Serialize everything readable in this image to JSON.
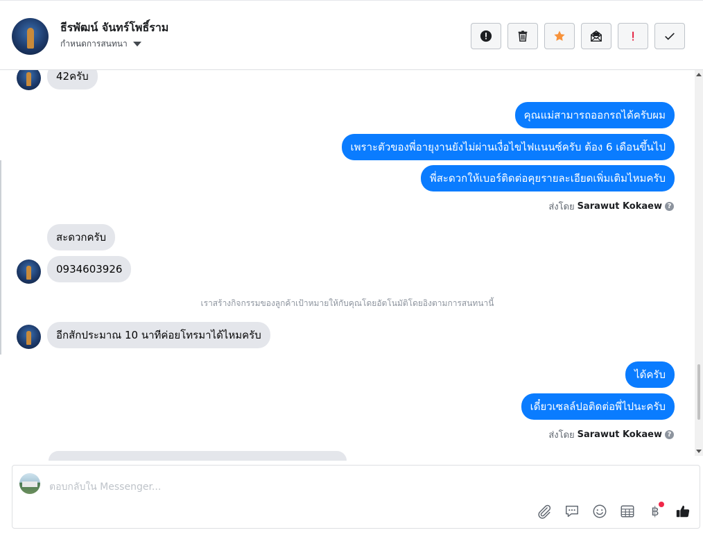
{
  "header": {
    "name": "ธีรพัฒน์ จันทร์โพธิ์ราม",
    "assign_label": "กำหนดการสนทนา",
    "toolbar": [
      {
        "id": "spam",
        "icon": "alert-circle-icon"
      },
      {
        "id": "delete",
        "icon": "trash-icon"
      },
      {
        "id": "star",
        "icon": "star-icon"
      },
      {
        "id": "unread",
        "icon": "envelope-open-icon"
      },
      {
        "id": "priority",
        "icon": "exclamation-icon"
      },
      {
        "id": "done",
        "icon": "check-icon"
      }
    ]
  },
  "messages": [
    {
      "dir": "in",
      "text": "42ครับ"
    },
    {
      "dir": "out",
      "text": "คุณแม่สามารถออกรถได้ครับผม"
    },
    {
      "dir": "out",
      "text": "เพราะตัวของพี่อายุงานยังไม่ผ่านเงื่อไขไฟแนนซ์ครับ ต้อง 6 เดือนขึ้นไป"
    },
    {
      "dir": "out",
      "text": "พี่สะดวกให้เบอร์ติดต่อคุยรายละเอียดเพิ่มเติมไหมครับ"
    },
    {
      "dir": "in",
      "text": "สะดวกครับ"
    },
    {
      "dir": "in",
      "text": "0934603926"
    },
    {
      "dir": "in",
      "text": "อีกสักประมาณ 10 นาทีค่อยโทรมาได้ไหมครับ"
    },
    {
      "dir": "out",
      "text": "ได้ครับ"
    },
    {
      "dir": "out",
      "text": "เดี๋ยวเซลล์ปอติดต่อพี่ไปนะครับ"
    }
  ],
  "sent_by": {
    "prefix": "ส่งโดย",
    "name": "Sarawut Kokaew"
  },
  "system_message": "เราสร้างกิจกรรมของลูกค้าเป้าหมายให้กับคุณโดยอัตโนมัติโดยอิงตามการสนทนานี้",
  "composer": {
    "placeholder": "ตอบกลับใน Messenger...",
    "tools": [
      {
        "id": "attach",
        "icon": "paperclip-icon"
      },
      {
        "id": "saved-replies",
        "icon": "speech-bubble-icon"
      },
      {
        "id": "emoji",
        "icon": "smiley-icon"
      },
      {
        "id": "appointment",
        "icon": "calendar-grid-icon"
      },
      {
        "id": "payment",
        "icon": "baht-icon",
        "glyph": "฿"
      },
      {
        "id": "like",
        "icon": "thumbs-up-icon"
      }
    ]
  },
  "colors": {
    "outgoing": "#0a7cff",
    "incoming": "#e4e6eb",
    "star": "#f7923b",
    "priority": "#e41e3f"
  }
}
